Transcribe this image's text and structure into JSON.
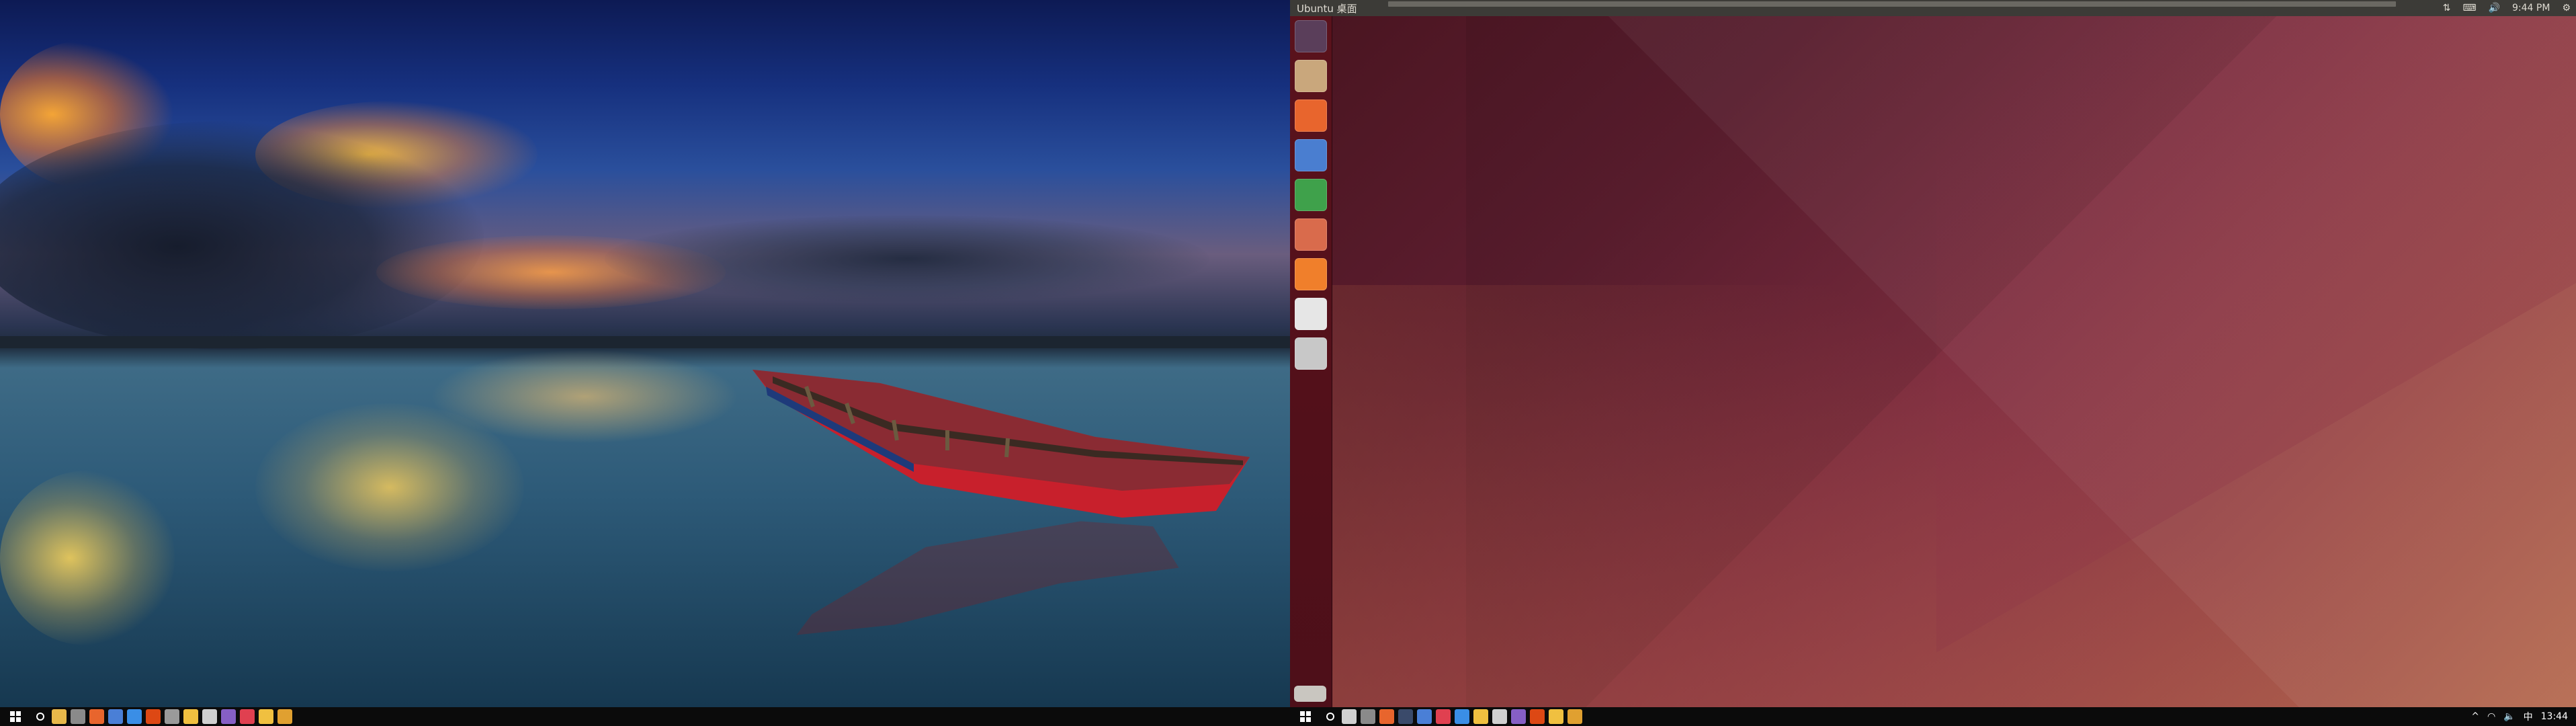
{
  "windows_desktop": {
    "wallpaper": "sunset-lake-with-red-boat",
    "taskbar": {
      "start_icon": "windows-logo-icon",
      "search_icon": "search-icon",
      "pinned_apps": [
        {
          "icon": "file-explorer-icon",
          "color": "#e8b84a"
        },
        {
          "icon": "photos-icon",
          "color": "#8a8a8a"
        },
        {
          "icon": "firefox-icon",
          "color": "#e8652d"
        },
        {
          "icon": "store-icon",
          "color": "#4a7fd6"
        },
        {
          "icon": "app-icon-blue",
          "color": "#3a8ee6"
        },
        {
          "icon": "ubuntu-vm-icon",
          "color": "#dd4814"
        },
        {
          "icon": "settings-icon",
          "color": "#9a9a9a"
        },
        {
          "icon": "folder-icon",
          "color": "#f0c040"
        },
        {
          "icon": "chrome-icon",
          "color": "#d0d0d0"
        },
        {
          "icon": "visual-studio-icon",
          "color": "#865fc5"
        },
        {
          "icon": "media-icon",
          "color": "#e04050"
        },
        {
          "icon": "folder-icon",
          "color": "#f0c040"
        },
        {
          "icon": "archive-icon",
          "color": "#e0a030"
        }
      ]
    }
  },
  "ubuntu": {
    "panel": {
      "title": "Ubuntu 桌面",
      "clock": "9:44 PM",
      "indicators": [
        "network-icon",
        "keyboard-icon",
        "volume-icon",
        "gear-icon"
      ]
    },
    "launcher": [
      {
        "name": "dash-icon",
        "color": "#5a3e5a"
      },
      {
        "name": "files-icon",
        "color": "#c9a77c"
      },
      {
        "name": "firefox-icon",
        "color": "#e8652d"
      },
      {
        "name": "writer-icon",
        "color": "#4a7ed0"
      },
      {
        "name": "calc-icon",
        "color": "#3fa14b"
      },
      {
        "name": "impress-icon",
        "color": "#d96b4c"
      },
      {
        "name": "software-center-icon",
        "color": "#f07f2b"
      },
      {
        "name": "amazon-icon",
        "color": "#e6e6e6"
      },
      {
        "name": "system-settings-icon",
        "color": "#c8c8c8"
      }
    ],
    "host_taskbar": {
      "pinned_apps": [
        {
          "icon": "chrome-icon",
          "color": "#d0d0d0"
        },
        {
          "icon": "photos-icon",
          "color": "#8a8a8a"
        },
        {
          "icon": "firefox-icon",
          "color": "#e8652d"
        },
        {
          "icon": "terminal-icon",
          "color": "#3a4a6a"
        },
        {
          "icon": "store-icon",
          "color": "#4a7fd6"
        },
        {
          "icon": "media-icon",
          "color": "#e04050"
        },
        {
          "icon": "edge-icon",
          "color": "#3a8ee6"
        },
        {
          "icon": "folder-icon",
          "color": "#f0c040"
        },
        {
          "icon": "chrome-icon",
          "color": "#d0d0d0"
        },
        {
          "icon": "visual-studio-icon",
          "color": "#865fc5"
        },
        {
          "icon": "ubuntu-vm-icon",
          "color": "#dd4814"
        },
        {
          "icon": "folder-icon",
          "color": "#f0c040"
        },
        {
          "icon": "archive-icon",
          "color": "#e0a030"
        }
      ],
      "tray": {
        "ime": "中",
        "time": "13:44"
      }
    }
  },
  "colors": {
    "ubuntu_launcher": "#5a121c",
    "ubuntu_panel": "#3c3b37",
    "taskbar": "#0b0b0b"
  }
}
